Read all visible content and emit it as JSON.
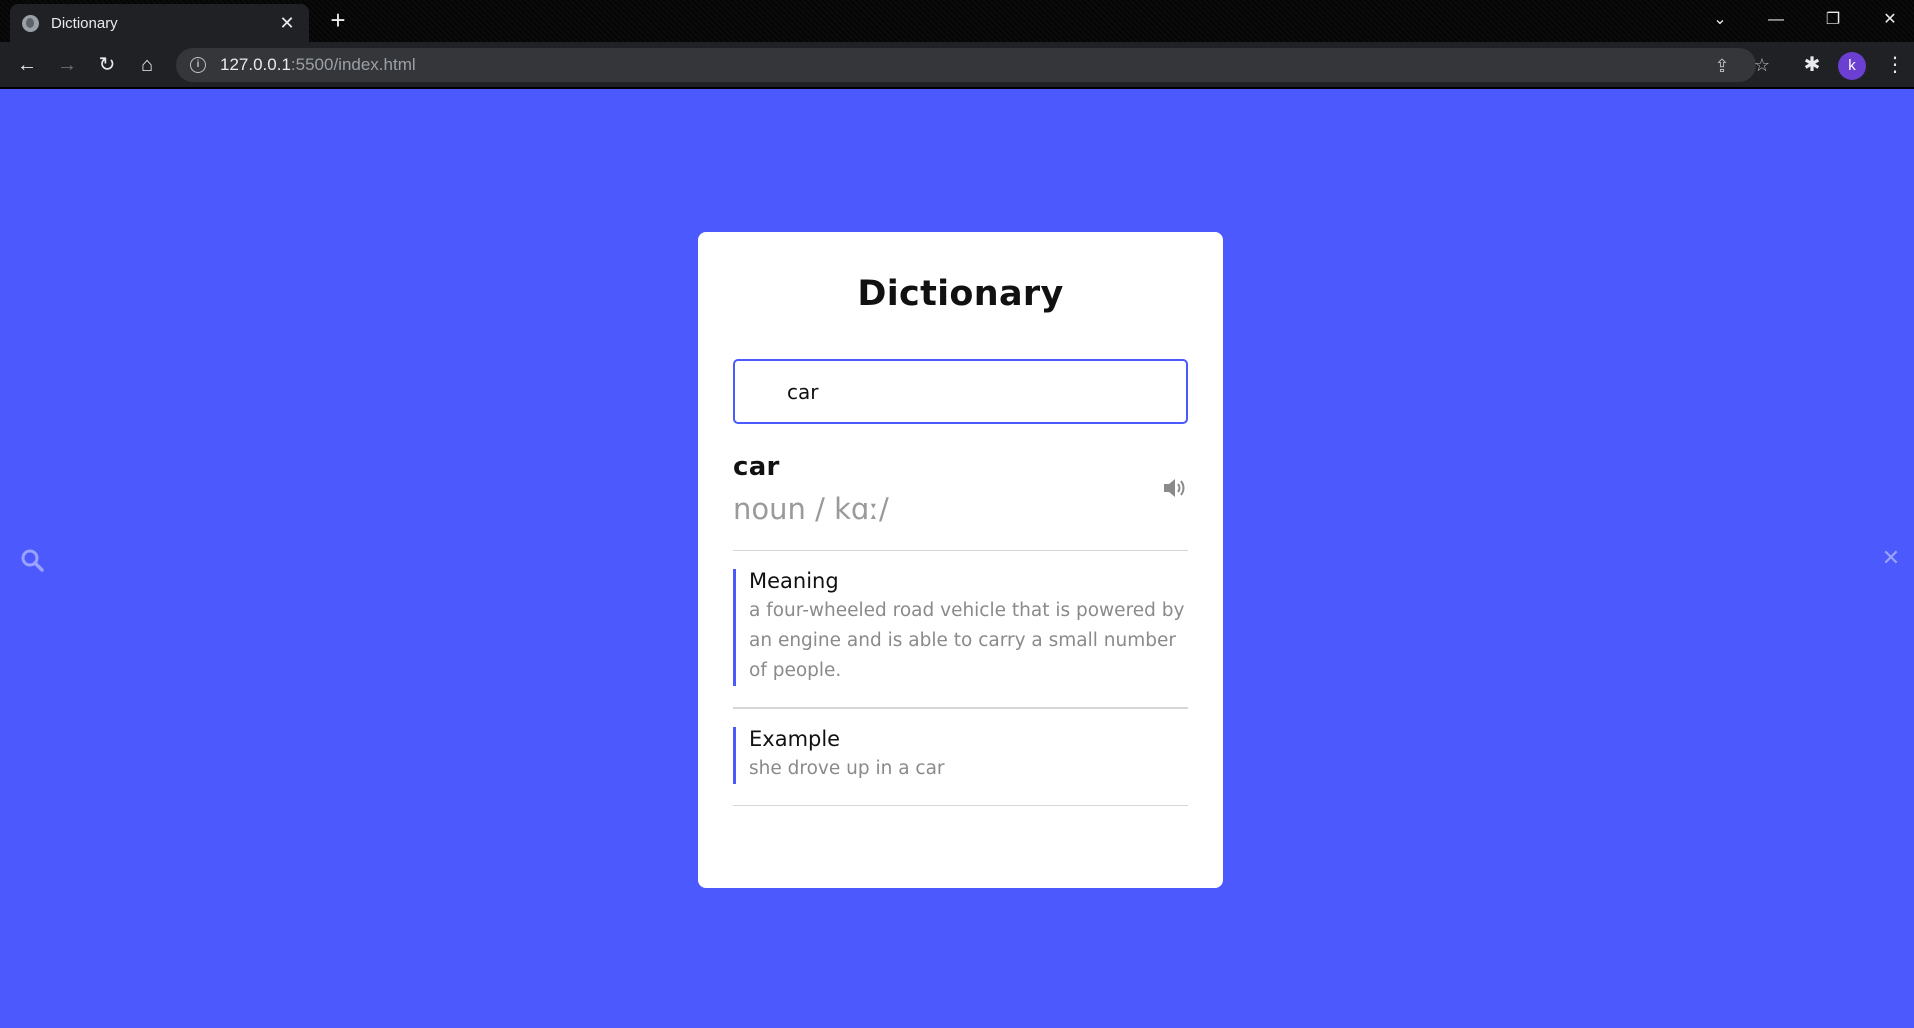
{
  "browser": {
    "tab_title": "Dictionary",
    "tab_close": "✕",
    "new_tab": "+",
    "url_host": "127.0.0.1",
    "url_path": ":5500/index.html",
    "profile_initial": "k"
  },
  "app": {
    "title": "Dictionary",
    "search_value": "car",
    "word": "car",
    "phonetic": "noun / kɑː/",
    "meaning_heading": "Meaning",
    "meaning_text": "a four-wheeled road vehicle that is powered by an engine and is able to carry a small number of people.",
    "example_heading": "Example",
    "example_text": "she drove up in a car",
    "close_icon": "✕"
  },
  "colors": {
    "background": "#4c59fc",
    "accent": "#4c59fc",
    "card": "#ffffff",
    "muted_text": "#8a8a8a"
  }
}
